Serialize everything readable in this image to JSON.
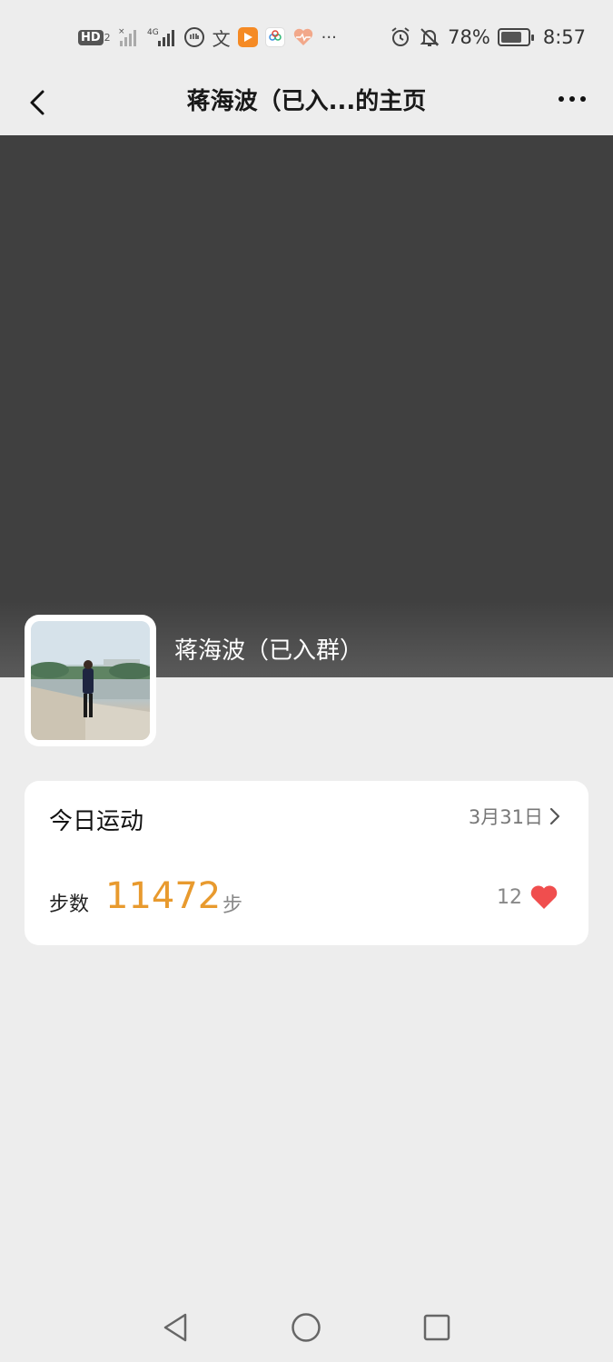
{
  "status_bar": {
    "hd_label": "HD",
    "hd_sub": "2",
    "signal_4g": "4G",
    "battery_percent": "78%",
    "time": "8:57",
    "overflow": "···",
    "app_icons": [
      "shield-icon",
      "translate-icon",
      "video-play-icon",
      "clover-icon",
      "heart-pulse-icon"
    ]
  },
  "nav": {
    "title": "蒋海波（已入...的主页",
    "back_icon": "chevron-left-icon",
    "more_icon": "more-dots-icon"
  },
  "profile": {
    "name": "蒋海波（已入群）",
    "cover_color": "#404040"
  },
  "card": {
    "title": "今日运动",
    "date": "3月31日",
    "steps_label": "步数",
    "steps_value": "11472",
    "steps_unit": "步",
    "likes": "12",
    "steps_color": "#e89a2e",
    "heart_color": "#f04e4e"
  },
  "system_nav": {
    "back_icon": "triangle-back-icon",
    "home_icon": "circle-home-icon",
    "recents_icon": "square-recents-icon"
  }
}
